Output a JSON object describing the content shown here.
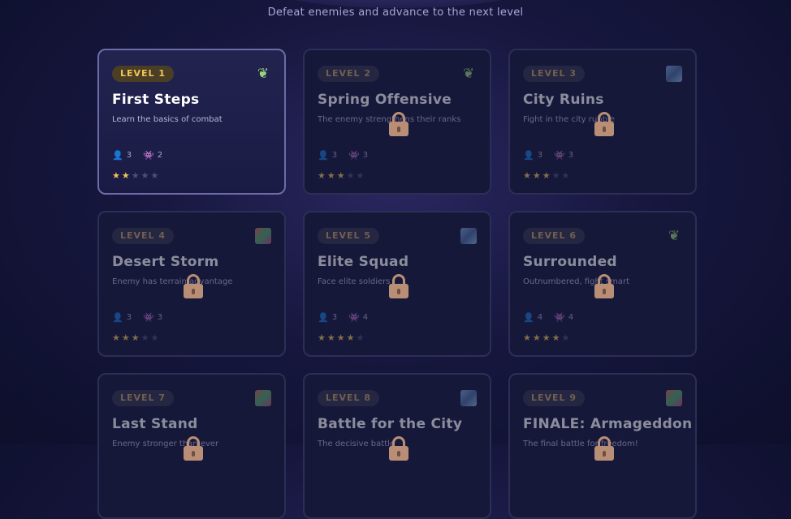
{
  "header": {
    "subtitle": "Defeat enemies and advance to the next level"
  },
  "levels": [
    {
      "badge": "LEVEL 1",
      "title": "First Steps",
      "desc": "Learn the basics of combat",
      "terrain": "forest-icon",
      "allies": "3",
      "enemies": "2",
      "stars": 2,
      "locked": false
    },
    {
      "badge": "LEVEL 2",
      "title": "Spring Offensive",
      "desc": "The enemy strengthens their ranks",
      "terrain": "forest-icon",
      "allies": "3",
      "enemies": "3",
      "stars": 3,
      "locked": true
    },
    {
      "badge": "LEVEL 3",
      "title": "City Ruins",
      "desc": "Fight in the city rubble",
      "terrain": "city-icon",
      "allies": "3",
      "enemies": "3",
      "stars": 3,
      "locked": true
    },
    {
      "badge": "LEVEL 4",
      "title": "Desert Storm",
      "desc": "Enemy has terrain advantage",
      "terrain": "desert-icon",
      "allies": "3",
      "enemies": "3",
      "stars": 3,
      "locked": true
    },
    {
      "badge": "LEVEL 5",
      "title": "Elite Squad",
      "desc": "Face elite soldiers",
      "terrain": "city-icon",
      "allies": "3",
      "enemies": "4",
      "stars": 4,
      "locked": true
    },
    {
      "badge": "LEVEL 6",
      "title": "Surrounded",
      "desc": "Outnumbered, fight smart",
      "terrain": "forest-icon",
      "allies": "4",
      "enemies": "4",
      "stars": 4,
      "locked": true
    },
    {
      "badge": "LEVEL 7",
      "title": "Last Stand",
      "desc": "Enemy stronger than ever",
      "terrain": "desert-icon",
      "allies": "",
      "enemies": "",
      "stars": 0,
      "locked": true
    },
    {
      "badge": "LEVEL 8",
      "title": "Battle for the City",
      "desc": "The decisive battle",
      "terrain": "city-icon",
      "allies": "",
      "enemies": "",
      "stars": 0,
      "locked": true
    },
    {
      "badge": "LEVEL 9",
      "title": "FINALE: Armageddon",
      "desc": "The final battle for freedom!",
      "terrain": "desert-icon",
      "allies": "",
      "enemies": "",
      "stars": 0,
      "locked": true
    }
  ],
  "star_count": 5
}
